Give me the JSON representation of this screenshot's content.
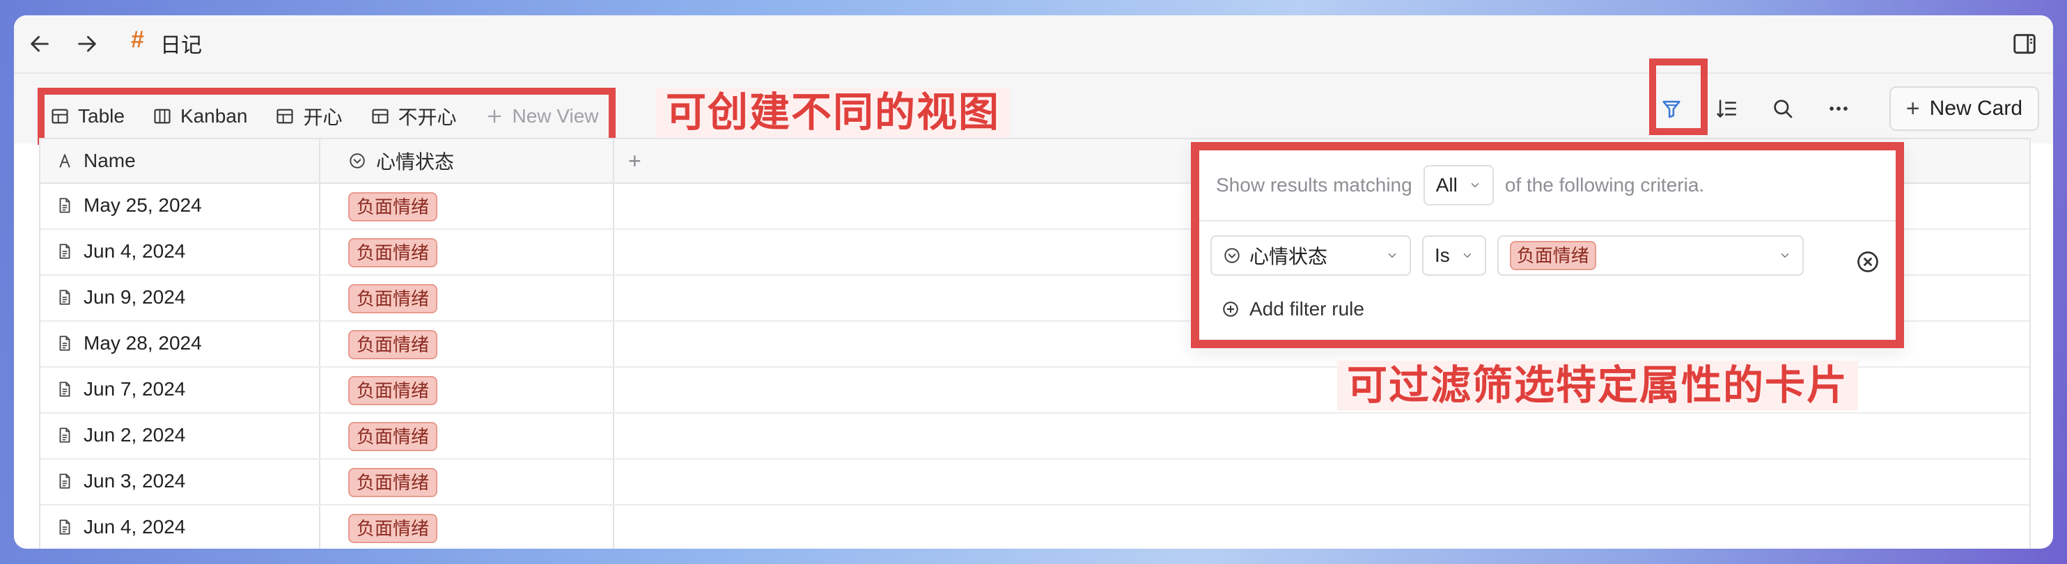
{
  "window": {
    "title": "日记",
    "title_hash": "#"
  },
  "views": [
    {
      "label": "Table",
      "icon": "table-icon"
    },
    {
      "label": "Kanban",
      "icon": "kanban-icon"
    },
    {
      "label": "开心",
      "icon": "table-icon"
    },
    {
      "label": "不开心",
      "icon": "table-icon"
    }
  ],
  "new_view_label": "New View",
  "new_card_label": "New Card",
  "annotations": {
    "views": "可创建不同的视图",
    "filter": "可过滤筛选特定属性的卡片"
  },
  "columns": [
    {
      "label": "Name",
      "icon": "text-type-icon"
    },
    {
      "label": "心情状态",
      "icon": "select-type-icon"
    }
  ],
  "add_column_label": "+",
  "rows": [
    {
      "name": "May 25, 2024",
      "mood": "负面情绪"
    },
    {
      "name": "Jun 4, 2024",
      "mood": "负面情绪"
    },
    {
      "name": "Jun 9, 2024",
      "mood": "负面情绪"
    },
    {
      "name": "May 28, 2024",
      "mood": "负面情绪"
    },
    {
      "name": "Jun 7, 2024",
      "mood": "负面情绪"
    },
    {
      "name": "Jun 2, 2024",
      "mood": "负面情绪"
    },
    {
      "name": "Jun 3, 2024",
      "mood": "负面情绪"
    },
    {
      "name": "Jun 4, 2024",
      "mood": "负面情绪"
    }
  ],
  "filter": {
    "prefix": "Show results matching",
    "match": "All",
    "suffix": "of the following criteria.",
    "rule": {
      "property": "心情状态",
      "operator": "Is",
      "value": "负面情绪"
    },
    "add_rule_label": "Add filter rule"
  },
  "colors": {
    "annotation": "#e04a48",
    "tag_bg": "#f6c7c0",
    "accent_filter": "#3a78d6"
  }
}
